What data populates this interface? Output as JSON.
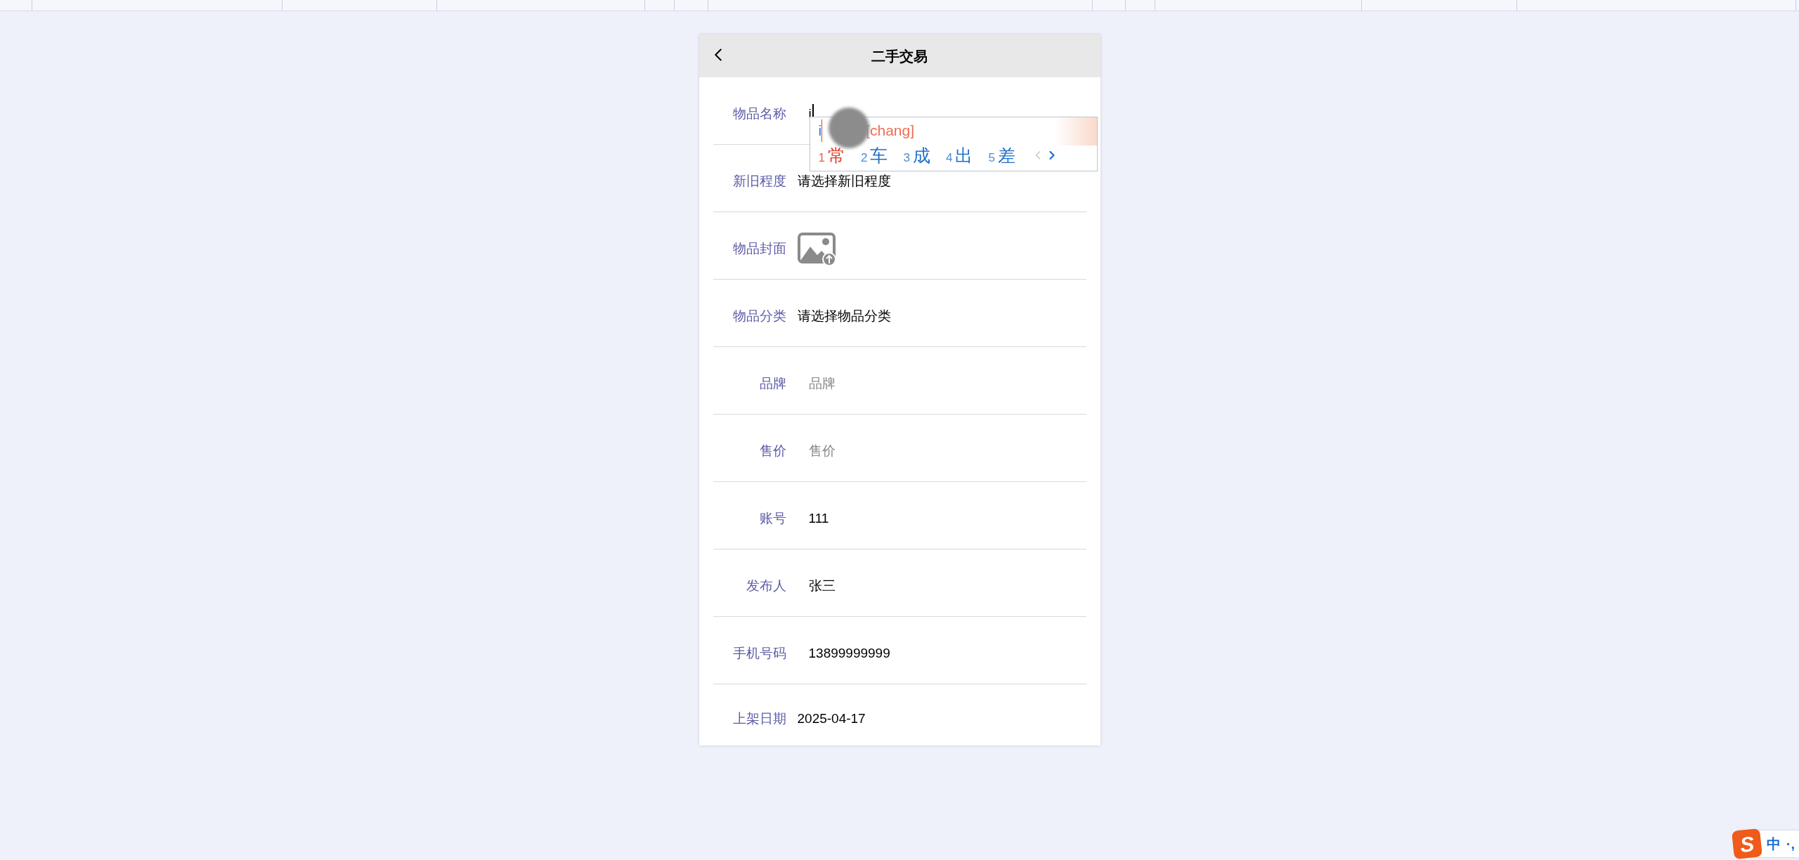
{
  "header": {
    "title": "二手交易"
  },
  "form": {
    "fields": [
      {
        "kind": "input",
        "label": "物品名称",
        "value": "i",
        "focused": true
      },
      {
        "kind": "picker",
        "label": "新旧程度",
        "text": "请选择新旧程度"
      },
      {
        "kind": "image",
        "label": "物品封面"
      },
      {
        "kind": "picker",
        "label": "物品分类",
        "text": "请选择物品分类"
      },
      {
        "kind": "input",
        "label": "品牌",
        "placeholder": "品牌",
        "focused": false
      },
      {
        "kind": "input",
        "label": "售价",
        "placeholder": "售价",
        "focused": false
      },
      {
        "kind": "input",
        "label": "账号",
        "value": "111",
        "focused": false
      },
      {
        "kind": "input",
        "label": "发布人",
        "value": "张三",
        "focused": false
      },
      {
        "kind": "input",
        "label": "手机号码",
        "value": "13899999999",
        "focused": false
      },
      {
        "kind": "picker",
        "label": "上架日期",
        "text": "2025-04-17"
      }
    ]
  },
  "ime_popup": {
    "composition": "i",
    "reading": "[chang]",
    "candidates": [
      {
        "index": "1",
        "text": "常",
        "selected": true
      },
      {
        "index": "2",
        "text": "车",
        "selected": false
      },
      {
        "index": "3",
        "text": "成",
        "selected": false
      },
      {
        "index": "4",
        "text": "出",
        "selected": false
      },
      {
        "index": "5",
        "text": "差",
        "selected": false
      }
    ],
    "prev_enabled": false,
    "next_enabled": true
  },
  "ime_status": {
    "logo": "S",
    "mode": "中",
    "punctuation": "·,"
  }
}
